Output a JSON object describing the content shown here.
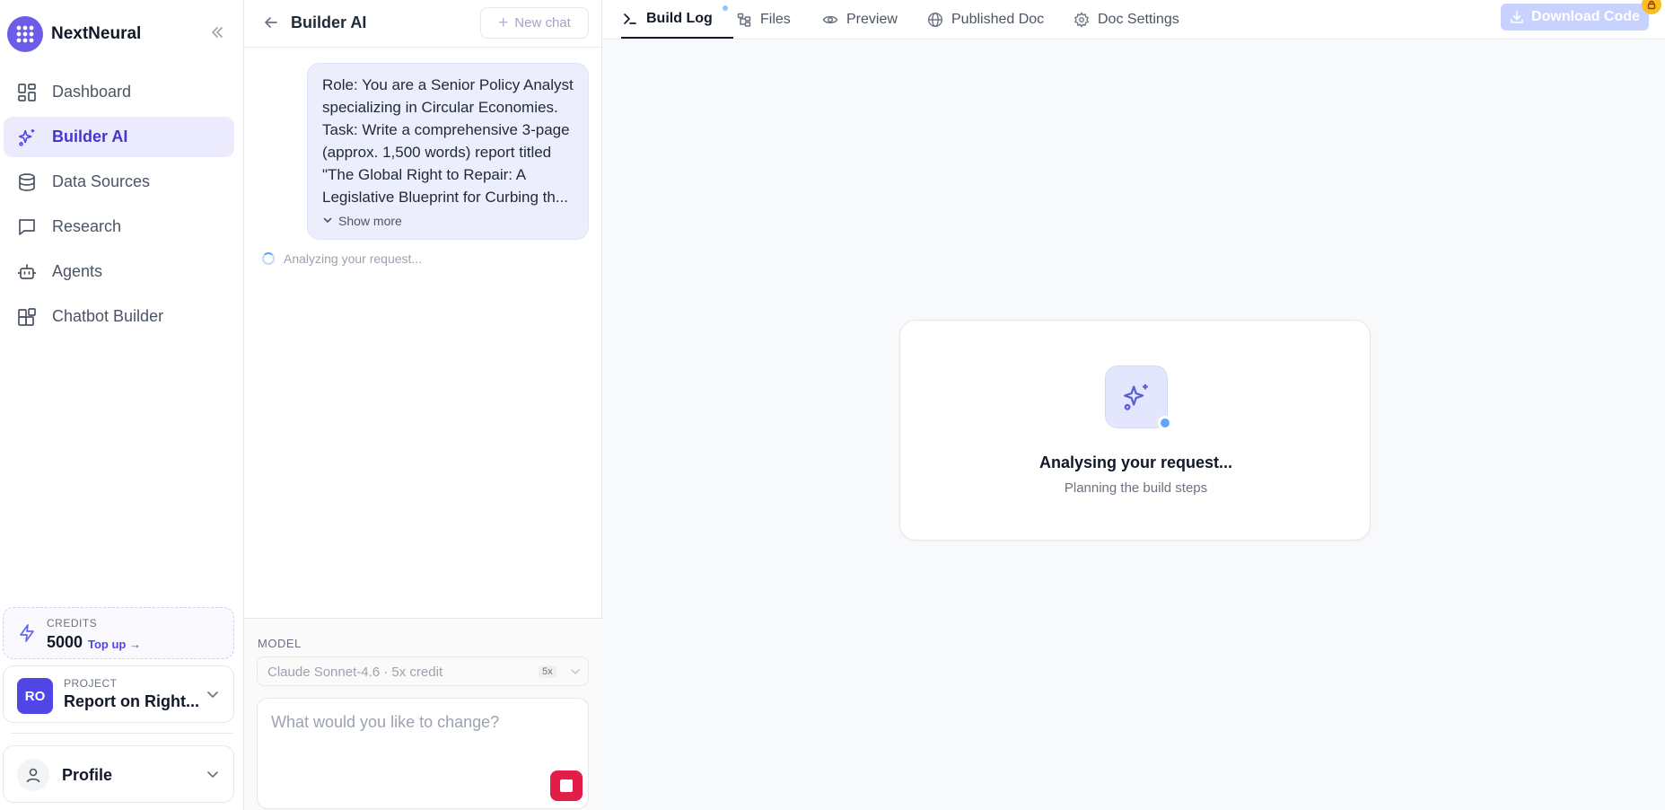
{
  "sidebar": {
    "brand": "NextNeural",
    "items": [
      {
        "label": "Dashboard",
        "icon": "dashboard-icon"
      },
      {
        "label": "Builder AI",
        "icon": "sparkles-icon",
        "active": true
      },
      {
        "label": "Data Sources",
        "icon": "database-icon"
      },
      {
        "label": "Research",
        "icon": "chat-bubble-icon"
      },
      {
        "label": "Agents",
        "icon": "robot-icon"
      },
      {
        "label": "Chatbot Builder",
        "icon": "blocks-icon"
      }
    ],
    "credits": {
      "label": "CREDITS",
      "value": "5000",
      "topup": "Top up →"
    },
    "project": {
      "label": "PROJECT",
      "initials": "RO",
      "name": "Report on Right..."
    },
    "profile": {
      "label": "Profile"
    }
  },
  "chat": {
    "title": "Builder AI",
    "new_chat": "New chat",
    "message": "Role: You are a Senior Policy Analyst specializing in Circular Economies. Task: Write a comprehensive 3-page (approx. 1,500 words) report titled \"The Global Right to Repair: A Legislative Blueprint for Curbing th...",
    "show_more": "Show more",
    "status": "Analyzing your request...",
    "model_label": "MODEL",
    "model_name": "Claude Sonnet-4.6 · 5x credit",
    "model_badge": "5x",
    "input_placeholder": "What would you like to change?"
  },
  "main": {
    "tabs": [
      {
        "label": "Build Log",
        "icon": "terminal-icon",
        "active": true
      },
      {
        "label": "Files",
        "icon": "file-tree-icon"
      },
      {
        "label": "Preview",
        "icon": "eye-icon"
      },
      {
        "label": "Published Doc",
        "icon": "globe-icon"
      },
      {
        "label": "Doc Settings",
        "icon": "gear-icon"
      }
    ],
    "download": "Download Code",
    "card_title": "Analysing your request...",
    "card_subtitle": "Planning the build steps"
  },
  "colors": {
    "accent": "#4f46e5",
    "brand_logo": "#6d5ce8",
    "stop_button": "#e11d48",
    "active_nav_bg": "#eceafd"
  }
}
